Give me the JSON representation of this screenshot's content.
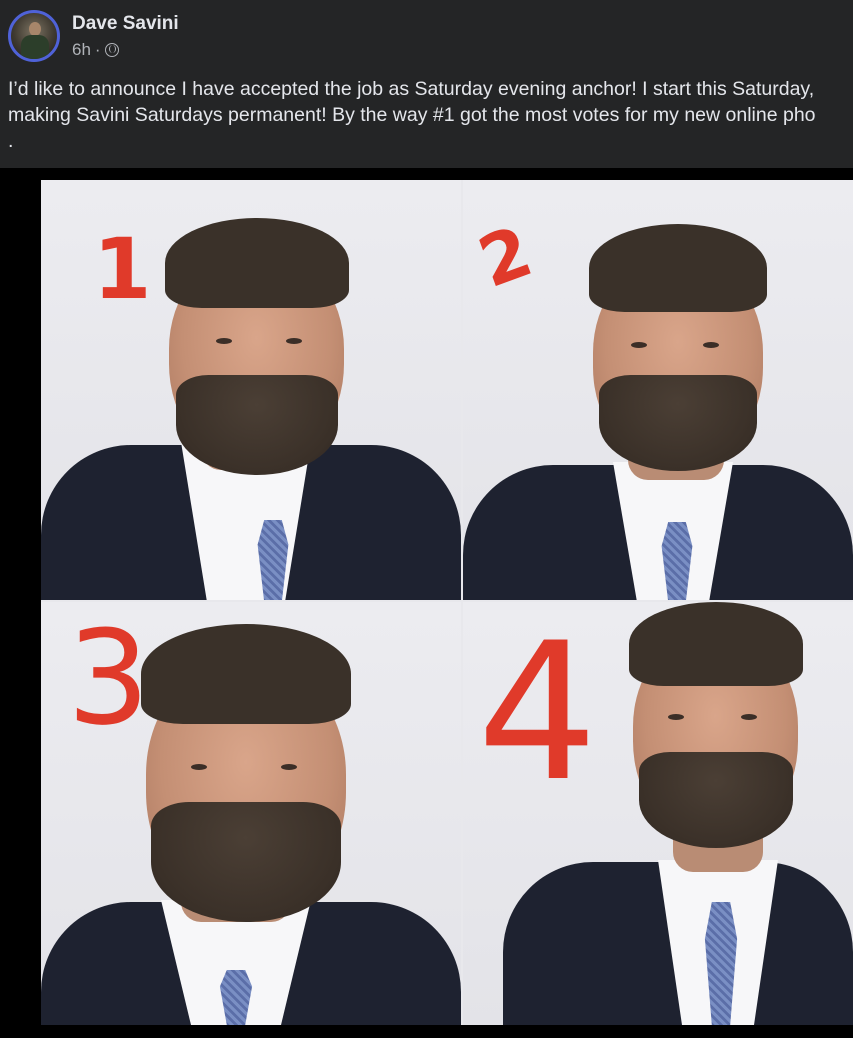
{
  "post": {
    "author": "Dave Savini",
    "time": "6h",
    "separator": "·",
    "caption_line1": "I’d like to announce I have accepted the job as Saturday evening anchor! I start this Saturday,",
    "caption_line2": "making Savini Saturdays permanent! By the way #1 got the most votes for my new online pho",
    "caption_line3": "."
  },
  "photo": {
    "panel_numbers": [
      "1",
      "2",
      "3",
      "4"
    ],
    "annotation_color": "#e03a2a"
  },
  "icons": {
    "privacy": "globe-icon",
    "avatar": "avatar"
  }
}
